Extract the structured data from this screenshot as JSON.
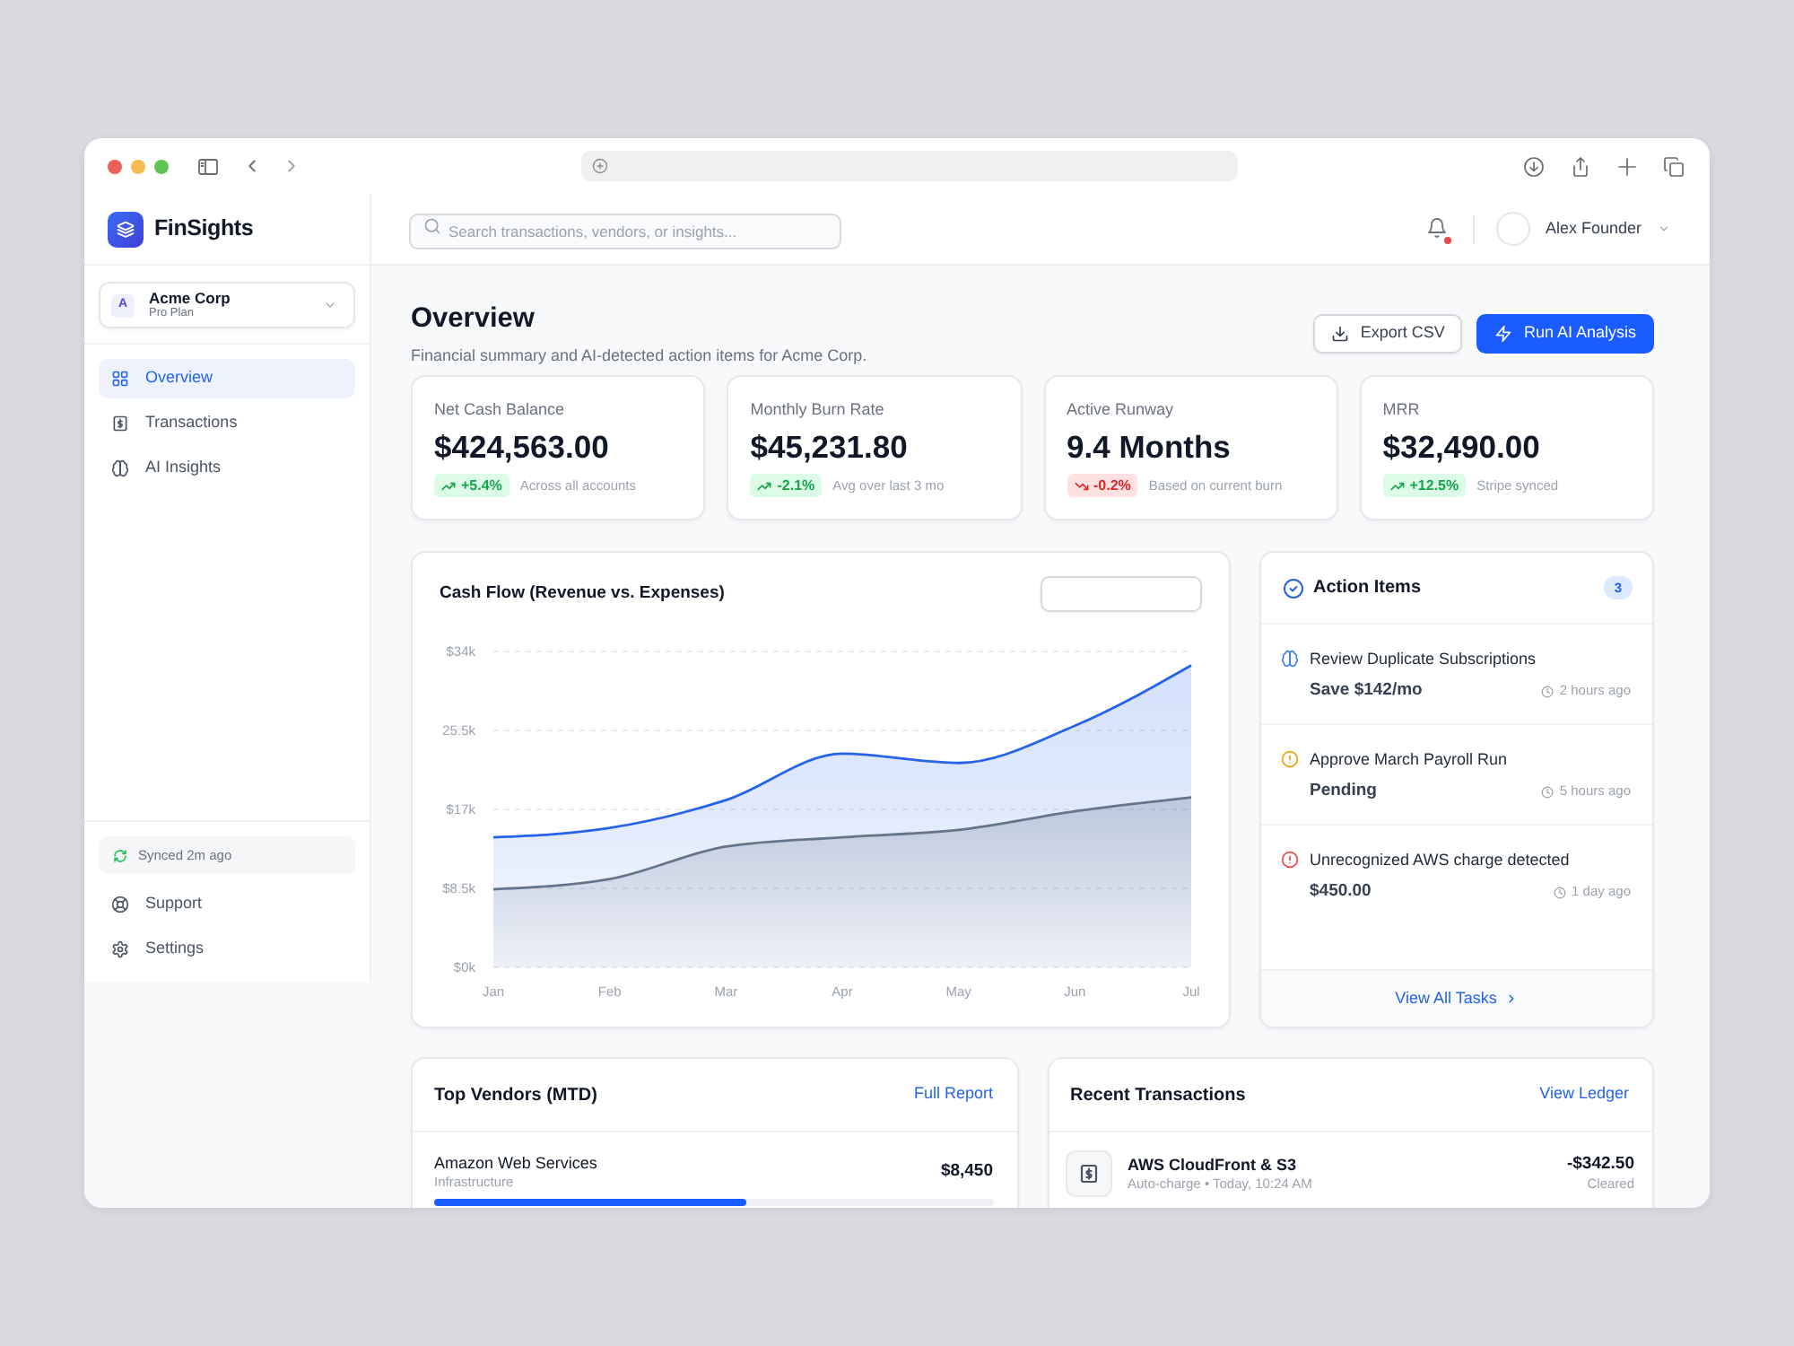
{
  "sidebar": {
    "brand": "FinSights",
    "workspace": {
      "initial": "A",
      "name": "Acme Corp",
      "plan": "Pro Plan"
    },
    "nav": [
      {
        "label": "Overview",
        "kind": "grid",
        "selected": true
      },
      {
        "label": "Transactions",
        "kind": "receipt",
        "selected": false
      },
      {
        "label": "AI Insights",
        "kind": "brain",
        "selected": false
      }
    ],
    "sync_status": "Synced 2m ago",
    "links": [
      {
        "label": "Support",
        "kind": "lifebuoy"
      },
      {
        "label": "Settings",
        "kind": "gear"
      }
    ]
  },
  "header": {
    "search": {
      "placeholder": "Search transactions, vendors, or insights..."
    },
    "unread_notifications": true,
    "user": {
      "name": "Alex Founder"
    }
  },
  "page": {
    "title": "Overview",
    "subtitle": "Financial summary and AI-detected action items for Acme Corp.",
    "actions": [
      {
        "label": "Export CSV",
        "kind": "export",
        "primary": false
      },
      {
        "label": "Run AI Analysis",
        "kind": "ai",
        "primary": true
      }
    ]
  },
  "stats": [
    {
      "label": "Net Cash Balance",
      "value": "$424,563.00",
      "change": "+5.4%",
      "rising": true,
      "positive": true,
      "note": "Across all accounts"
    },
    {
      "label": "Monthly Burn Rate",
      "value": "$45,231.80",
      "change": "-2.1%",
      "rising": true,
      "positive": true,
      "note": "Avg over last 3 mo"
    },
    {
      "label": "Active Runway",
      "value": "9.4 Months",
      "change": "-0.2%",
      "rising": false,
      "positive": false,
      "note": "Based on current burn"
    },
    {
      "label": "MRR",
      "value": "$32,490.00",
      "change": "+12.5%",
      "rising": true,
      "positive": true,
      "note": "Stripe synced"
    }
  ],
  "cash_flow": {
    "chart_data": {
      "type": "area",
      "title": "Cash Flow (Revenue vs. Expenses)",
      "categories": [
        "Jan",
        "Feb",
        "Mar",
        "Apr",
        "May",
        "Jun",
        "Jul"
      ],
      "series": [
        {
          "color": "#2563eb",
          "values": [
            14000,
            15000,
            18000,
            23000,
            22000,
            26000,
            32500
          ]
        },
        {
          "color": "#64748b",
          "values": [
            8400,
            9500,
            13000,
            14000,
            14800,
            16800,
            18300
          ]
        }
      ],
      "ylim": [
        0,
        34000
      ],
      "yticks": [
        {
          "value": 0,
          "label": "$0k"
        },
        {
          "value": 8500,
          "label": "$8.5k"
        },
        {
          "value": 17000,
          "label": "$17k"
        },
        {
          "value": 25500,
          "label": "25.5k"
        },
        {
          "value": 34000,
          "label": "$34k"
        }
      ],
      "grid": true
    }
  },
  "action_items": {
    "title": "Action Items",
    "count": "3",
    "items": [
      {
        "kind": "insight",
        "title": "Review Duplicate Subscriptions",
        "detail": "Save $142/mo",
        "time": "2 hours ago"
      },
      {
        "kind": "warning",
        "title": "Approve March Payroll Run",
        "detail": "Pending",
        "time": "5 hours ago"
      },
      {
        "kind": "alert",
        "title": "Unrecognized AWS charge detected",
        "detail": "$450.00",
        "time": "1 day ago"
      }
    ],
    "footer_link": "View All Tasks"
  },
  "top_vendors": {
    "title": "Top Vendors (MTD)",
    "link": "Full Report",
    "rows": [
      {
        "name": "Amazon Web Services",
        "category": "Infrastructure",
        "amount": "$8,450",
        "level": 0.56
      }
    ]
  },
  "recent_transactions": {
    "title": "Recent Transactions",
    "link": "View Ledger",
    "rows": [
      {
        "name": "AWS CloudFront & S3",
        "detail": "Auto-charge • Today, 10:24 AM",
        "amount": "-$342.50",
        "status": "Cleared"
      }
    ]
  }
}
